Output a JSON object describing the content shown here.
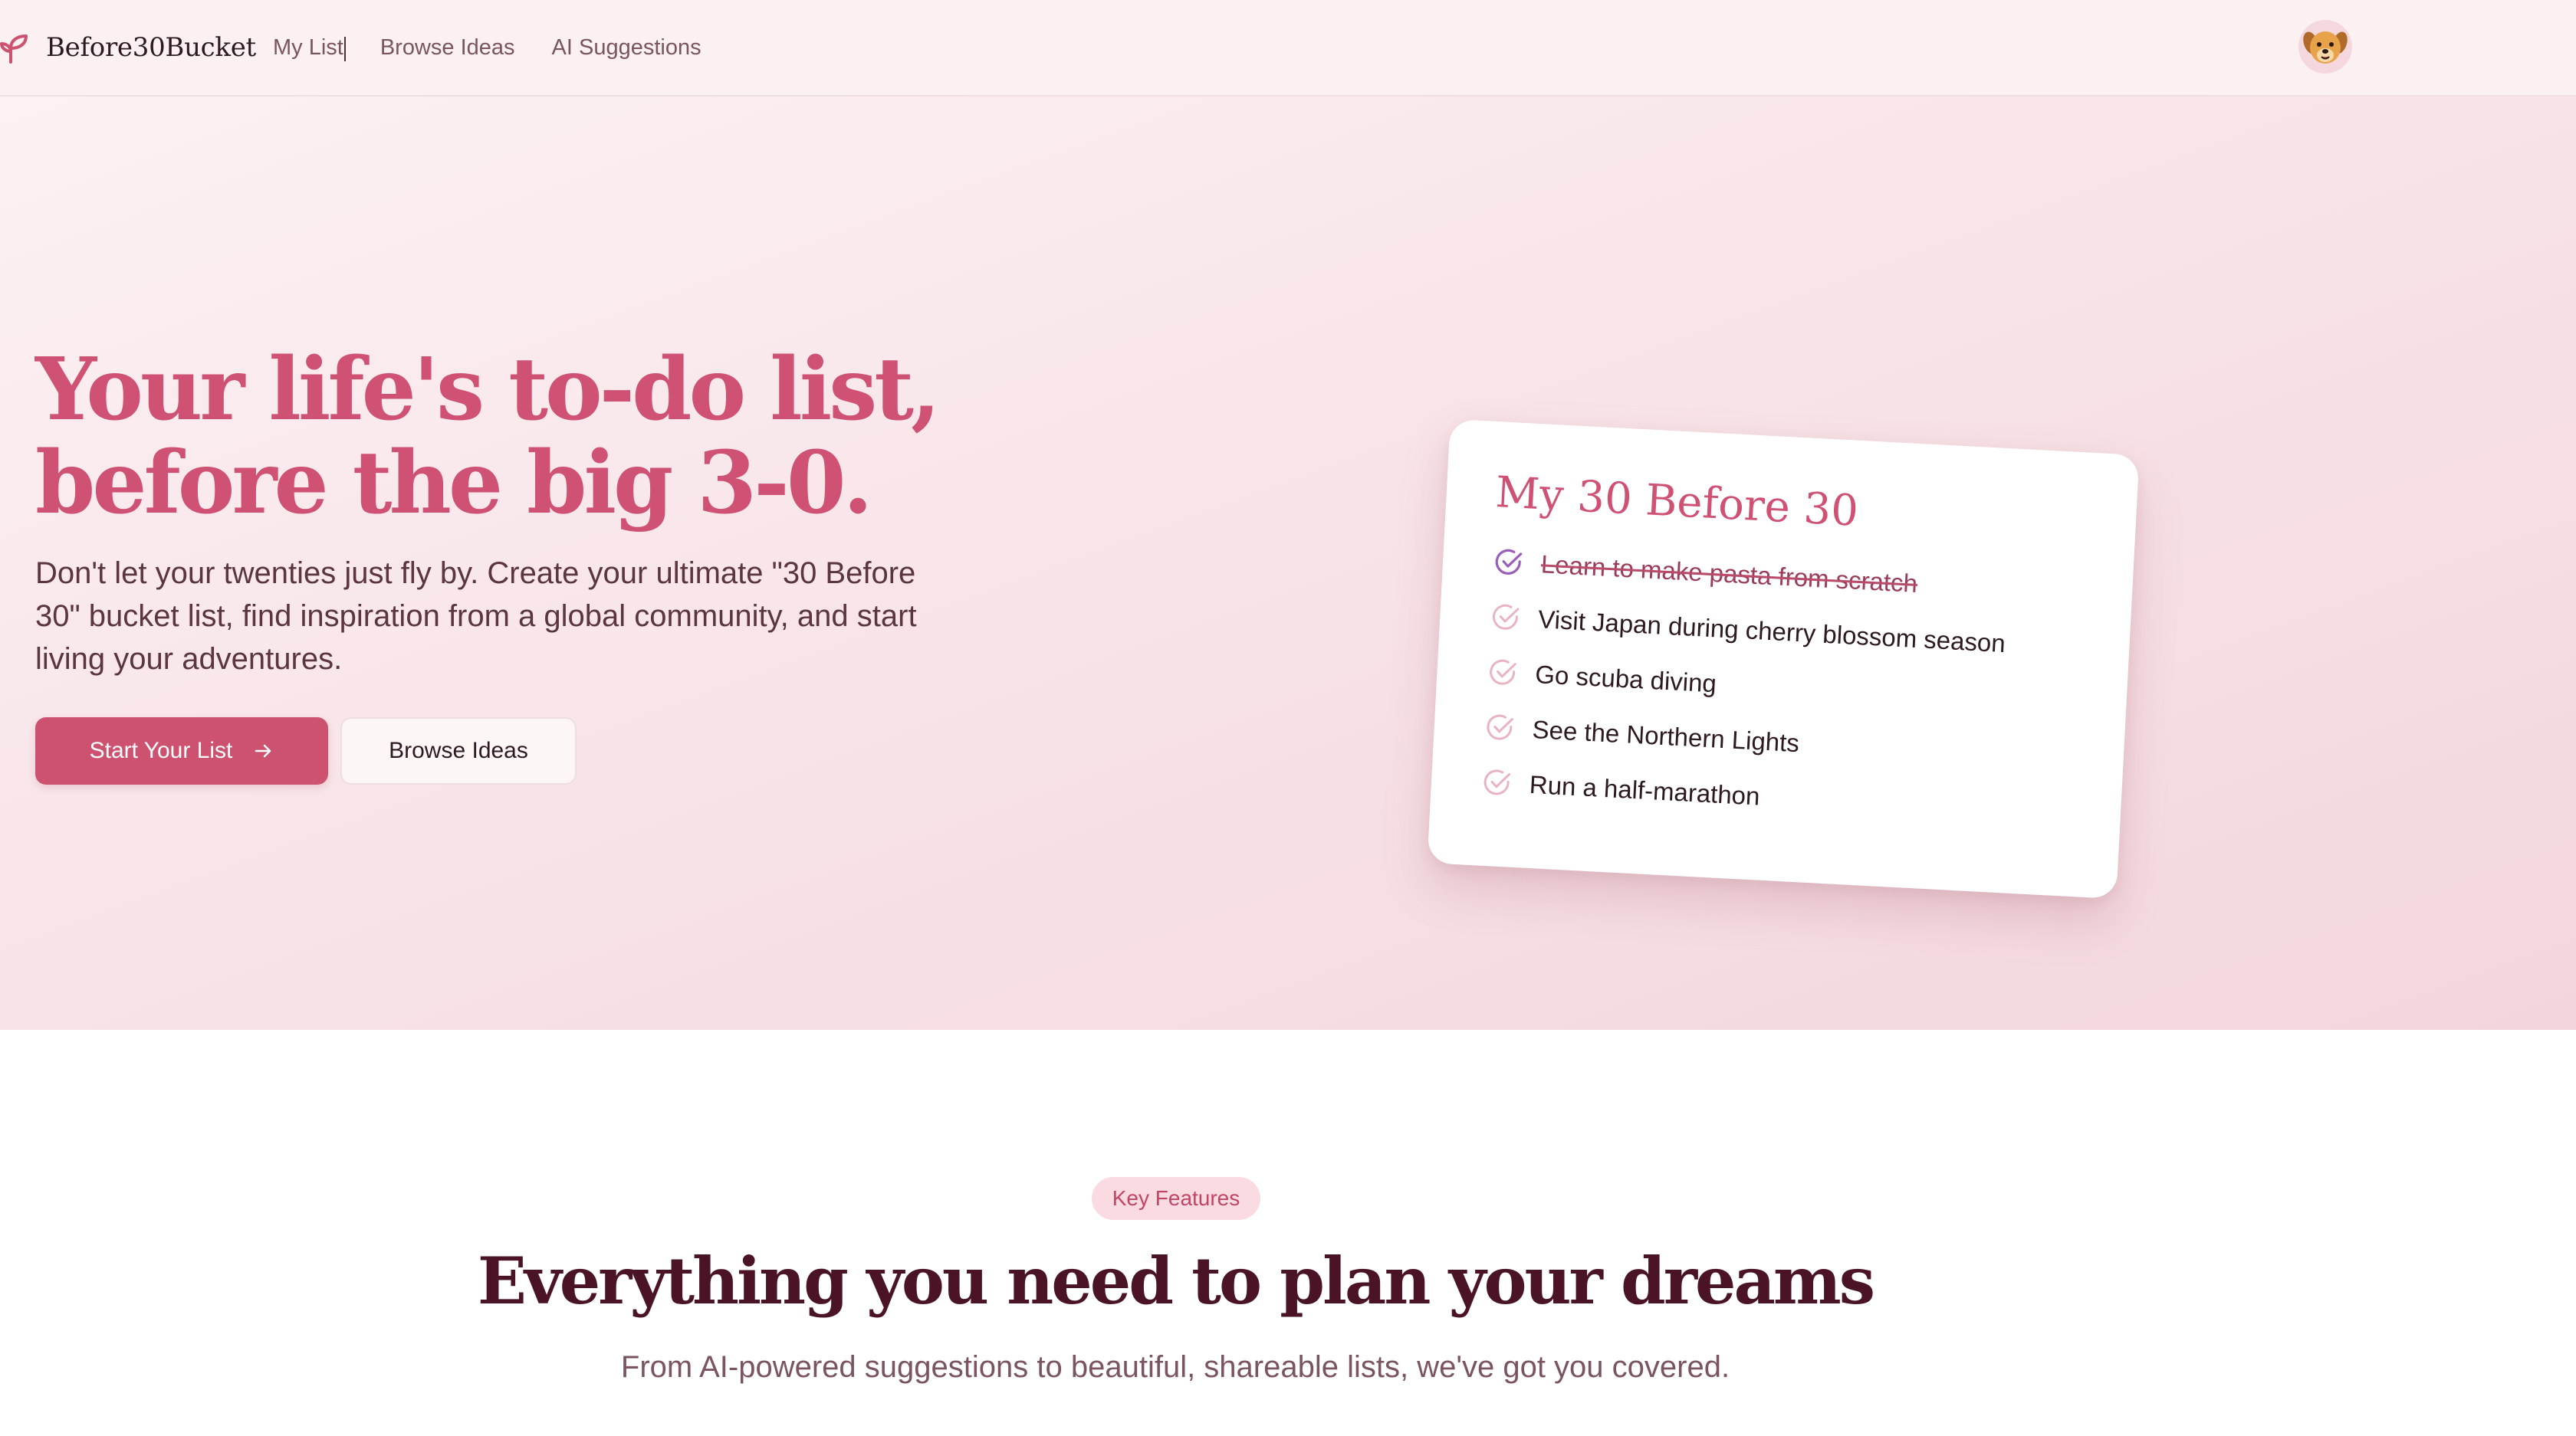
{
  "nav": {
    "brand": "Before30Bucket",
    "links": [
      "My List",
      "Browse Ideas",
      "AI Suggestions"
    ],
    "avatar_icon": "dog-face-icon"
  },
  "hero": {
    "title": "Your life's to-do list, before the big 3-0.",
    "subtitle": "Don't let your twenties just fly by. Create your ultimate \"30 Before 30\" bucket list, find inspiration from a global community, and start living your adventures.",
    "primary_button": "Start Your List",
    "secondary_button": "Browse Ideas"
  },
  "card": {
    "title": "My 30 Before 30",
    "items": [
      {
        "text": "Learn to make pasta from scratch",
        "done": true
      },
      {
        "text": "Visit Japan during cherry blossom season",
        "done": false
      },
      {
        "text": "Go scuba diving",
        "done": false
      },
      {
        "text": "See the Northern Lights",
        "done": false
      },
      {
        "text": "Run a half-marathon",
        "done": false
      }
    ]
  },
  "features": {
    "badge": "Key Features",
    "title": "Everything you need to plan your dreams",
    "subtitle": "From AI-powered suggestions to beautiful, shareable lists, we've got you covered."
  },
  "colors": {
    "accent": "#cd5270",
    "accent_text": "#cf5275",
    "dark_text": "#2d1a20",
    "heading_dark": "#4a1426"
  }
}
